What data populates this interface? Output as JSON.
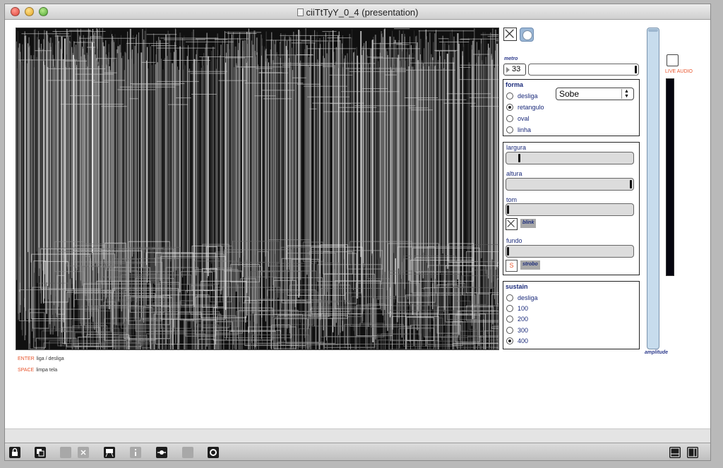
{
  "window": {
    "title": "ciiTtTyY_0_4 (presentation)"
  },
  "shortcuts": [
    {
      "key": "ENTER",
      "action": "liga / desliga"
    },
    {
      "key": "SPACE",
      "action": "limpa tela"
    }
  ],
  "metro": {
    "label": "metro",
    "value": "33"
  },
  "forma": {
    "title": "forma",
    "options": [
      "desliga",
      "retangulo",
      "oval",
      "linha"
    ],
    "selected": "retangulo",
    "direction": "Sobe"
  },
  "params": {
    "largura": "largura",
    "altura": "altura",
    "tom": "tom",
    "blink": "blink",
    "fundo": "fundo",
    "strobo_key": "S",
    "strobo": "strobo"
  },
  "sustain": {
    "title": "sustain",
    "options": [
      "desliga",
      "100",
      "200",
      "300",
      "400"
    ],
    "selected": "400"
  },
  "amplitude_label": "amplitude",
  "live_audio_label": "LIVE AUDIO",
  "colors": {
    "label_blue": "#1a2a7a",
    "accent_orange": "#e8542c",
    "amp_fill": "#c7dced"
  }
}
